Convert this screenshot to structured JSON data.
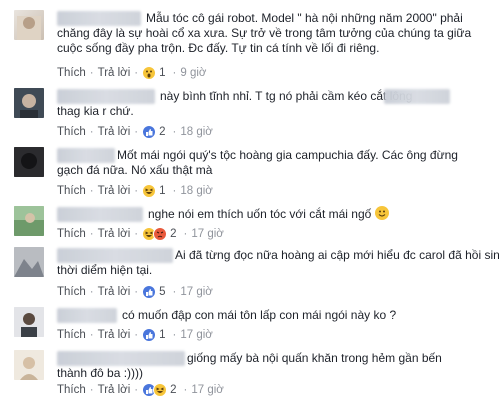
{
  "ui": {
    "reply_label": "Trả lời",
    "like_label": "Thích",
    "separator": "·"
  },
  "comments": [
    {
      "lines": [
        "Mẫu tóc cô gái robot. Model \" hà nội những năm 2000\" phải",
        "chăng đây là sự hoài cổ xa xưa. Sự trở về trong tâm tưởng của chúng ta giữa",
        "cuộc sống đầy pha trộn. Đc đấy. Tự tin cá tính về lối đi riêng."
      ],
      "reactions": [
        "wow"
      ],
      "count": "1",
      "time": "9 giờ"
    },
    {
      "lines": [
        "này bình tĩnh nhỉ. T tg nó phải cầm kéo cắt lông",
        "thag kia r chứ."
      ],
      "reactions": [
        "like"
      ],
      "count": "2",
      "time": "18 giờ"
    },
    {
      "lines": [
        "Mốt mái ngói quý's tộc hoàng gia campuchia đấy. Các ông đừng",
        "gạch đá nữa. Nó xấu thật mà"
      ],
      "reactions": [
        "haha"
      ],
      "count": "1",
      "time": "18 giờ"
    },
    {
      "lines": [
        "nghe nói em thích uốn tóc với cắt mái ngố"
      ],
      "reactions": [
        "haha",
        "angry"
      ],
      "count": "2",
      "time": "17 giờ"
    },
    {
      "lines": [
        "Ai đã từng đọc nữa hoàng ai cập mới hiểu đc carol đã hồi sinh ở",
        "thời diểm hiện tại."
      ],
      "reactions": [
        "like"
      ],
      "count": "5",
      "time": "17 giờ"
    },
    {
      "lines": [
        "có muốn đập con mái tôn lấp con mái ngói này ko ?"
      ],
      "reactions": [
        "like"
      ],
      "count": "1",
      "time": "17 giờ"
    },
    {
      "lines": [
        "giống mấy bà nội quấn khăn trong hẻm gần bến",
        "thành đô ba :))))"
      ],
      "reactions": [
        "like",
        "haha"
      ],
      "count": "2",
      "time": "17 giờ"
    }
  ]
}
